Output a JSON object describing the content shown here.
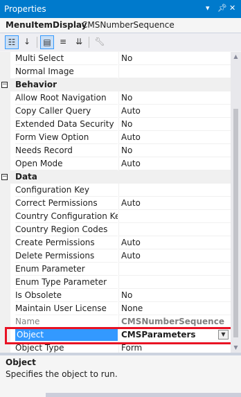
{
  "window": {
    "title": "Properties"
  },
  "object_selector": {
    "name": "MenuItemDisplay",
    "type": "CMSNumberSequence"
  },
  "toolbar": {
    "icons": [
      "categorized-icon",
      "alphabetical-icon",
      "properties-icon",
      "events-icon",
      "property-pages-icon",
      "wrench-icon"
    ]
  },
  "rows": [
    {
      "kind": "prop",
      "name": "Multi Select",
      "value": "No"
    },
    {
      "kind": "prop",
      "name": "Normal Image",
      "value": ""
    },
    {
      "kind": "cat",
      "name": "Behavior"
    },
    {
      "kind": "prop",
      "name": "Allow Root Navigation",
      "value": "No"
    },
    {
      "kind": "prop",
      "name": "Copy Caller Query",
      "value": "Auto"
    },
    {
      "kind": "prop",
      "name": "Extended Data Security",
      "value": "No"
    },
    {
      "kind": "prop",
      "name": "Form View Option",
      "value": "Auto"
    },
    {
      "kind": "prop",
      "name": "Needs Record",
      "value": "No"
    },
    {
      "kind": "prop",
      "name": "Open Mode",
      "value": "Auto"
    },
    {
      "kind": "cat",
      "name": "Data"
    },
    {
      "kind": "prop",
      "name": "Configuration Key",
      "value": ""
    },
    {
      "kind": "prop",
      "name": "Correct Permissions",
      "value": "Auto"
    },
    {
      "kind": "prop",
      "name": "Country Configuration Key",
      "value": ""
    },
    {
      "kind": "prop",
      "name": "Country Region Codes",
      "value": ""
    },
    {
      "kind": "prop",
      "name": "Create Permissions",
      "value": "Auto"
    },
    {
      "kind": "prop",
      "name": "Delete Permissions",
      "value": "Auto"
    },
    {
      "kind": "prop",
      "name": "Enum Parameter",
      "value": ""
    },
    {
      "kind": "prop",
      "name": "Enum Type Parameter",
      "value": ""
    },
    {
      "kind": "prop",
      "name": "Is Obsolete",
      "value": "No"
    },
    {
      "kind": "prop",
      "name": "Maintain User License",
      "value": "None"
    },
    {
      "kind": "prop",
      "name": "Name",
      "value": "CMSNumberSequence",
      "dim": true
    },
    {
      "kind": "prop",
      "name": "Object",
      "value": "CMSParameters",
      "selected": true
    },
    {
      "kind": "prop",
      "name": "Object Type",
      "value": "Form"
    }
  ],
  "description": {
    "title": "Object",
    "text": "Specifies the object to run."
  }
}
